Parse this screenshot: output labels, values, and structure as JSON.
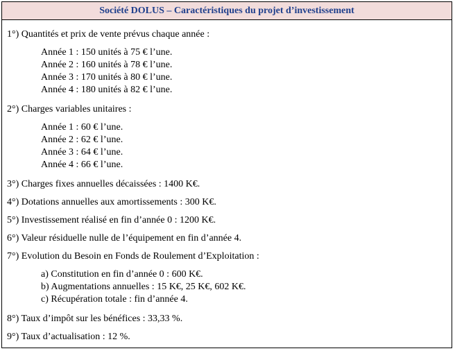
{
  "title": "Société DOLUS – Caractéristiques du projet d’investissement",
  "items": [
    {
      "heading": "1°) Quantités et prix de vente prévus chaque année :",
      "sub": [
        "Année 1 : 150 unités à 75 € l’une.",
        "Année 2 : 160 unités à 78 € l’une.",
        "Année 3 : 170 unités à 80 € l’une.",
        "Année 4 : 180 unités à 82 € l’une."
      ]
    },
    {
      "heading": "2°) Charges variables unitaires :",
      "sub": [
        "Année 1 : 60 € l’une.",
        "Année 2 : 62 € l’une.",
        "Année 3 : 64 € l’une.",
        "Année 4 : 66 € l’une."
      ]
    },
    {
      "heading": "3°) Charges fixes annuelles décaissées : 1400 K€."
    },
    {
      "heading": "4°) Dotations annuelles aux amortissements : 300 K€."
    },
    {
      "heading": "5°) Investissement réalisé en fin d’année 0 : 1200 K€."
    },
    {
      "heading": "6°) Valeur résiduelle nulle de l’équipement en fin d’année 4."
    },
    {
      "heading": "7°) Evolution du Besoin en Fonds de Roulement d’Exploitation :",
      "sub": [
        "a) Constitution en fin d’année 0 : 600 K€.",
        "b) Augmentations annuelles : 15 K€, 25 K€, 602 K€.",
        "c) Récupération totale : fin d’année 4."
      ]
    },
    {
      "heading": "8°) Taux d’impôt sur les bénéfices : 33,33 %."
    },
    {
      "heading": "9°) Taux d’actualisation : 12 %."
    }
  ]
}
